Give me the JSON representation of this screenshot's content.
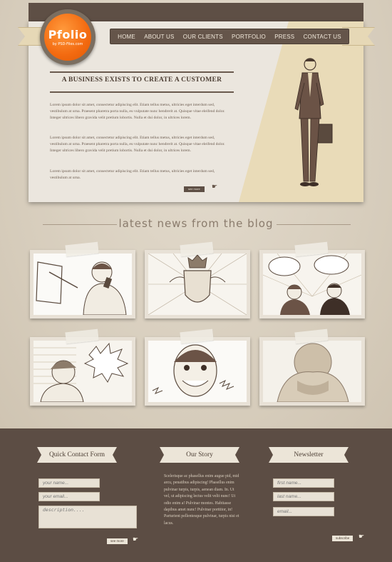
{
  "brand": {
    "name": "Pfolio",
    "tagline": "by PSD-Files.com"
  },
  "nav": {
    "items": [
      "HOME",
      "ABOUT US",
      "OUR CLIENTS",
      "PORTFOLIO",
      "PRESS",
      "CONTACT US"
    ]
  },
  "hero": {
    "title": "A BUSINESS EXISTS TO CREATE A CUSTOMER",
    "paragraphs": [
      "Lorem ipsum dolor sit amet, consectetur adipiscing elit. Etiam tellus metus, ultricies eget interdum sed, vestibulum at urna. Praesent pharetra porta nulla, eu vulputate nunc hendrerit at. Quisque vitae eleifend dolor. Integer ultrices libero gravida velit pretium lobortis. Nulla et dui dolor, in ultrices lorem.",
      "Lorem ipsum dolor sit amet, consectetur adipiscing elit. Etiam tellus metus, ultricies eget interdum sed, vestibulum at urna. Praesent pharetra porta nulla, eu vulputate nunc hendrerit at. Quisque vitae eleifend dolor. Integer ultrices libero gravida velit pretium lobortis. Nulla et dui dolor, in ultrices lorem.",
      "Lorem ipsum dolor sit amet, consectetur adipiscing elit. Etiam tellus metus, ultricies eget interdum sed, vestibulum at urna."
    ],
    "button": "see more"
  },
  "blog": {
    "heading": "latest news from the blog"
  },
  "footer": {
    "contact": {
      "title": "Quick Contact Form",
      "name_placeholder": "your name...",
      "email_placeholder": "your email...",
      "description_placeholder": "description....",
      "button": "see more"
    },
    "story": {
      "title": "Our Story",
      "text": "Scelerisque ac phasellus enim augue pid, mid arcu, penatibus adipiscing! Phasellus enim pulvinar turpis, turpis, aenean diam. In. Ut vel, ut adipiscing lectus velit velit nunc! Ut odio enim a! Pulvinar montes. Habitasse dapibus amet nunc! Pulvinar porttitor, in! Parturient pellentesque pulvinar, turpis nisi et lacus."
    },
    "newsletter": {
      "title": "Newsletter",
      "first_placeholder": "first name...",
      "last_placeholder": "last name...",
      "email_placeholder": "email...",
      "button": "subscribe"
    }
  },
  "colors": {
    "brand_orange": "#f36a10",
    "dark_brown": "#5c4d44",
    "cream": "#ebe6de"
  }
}
